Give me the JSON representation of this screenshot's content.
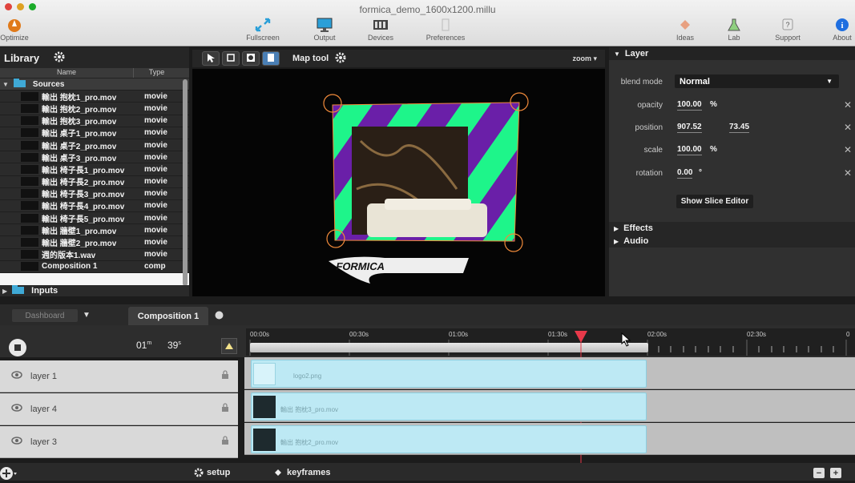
{
  "window": {
    "title": "formica_demo_1600x1200.millu"
  },
  "toolbar": {
    "optimize": "Optimize",
    "fullscreen": "Fullscreen",
    "output": "Output",
    "devices": "Devices",
    "preferences": "Preferences",
    "ideas": "Ideas",
    "lab": "Lab",
    "support": "Support",
    "about": "About"
  },
  "library": {
    "title": "Library",
    "col_name": "Name",
    "col_type": "Type",
    "sources_label": "Sources",
    "items": [
      {
        "name": "輸出 抱枕1_pro.mov",
        "type": "movie"
      },
      {
        "name": "輸出 抱枕2_pro.mov",
        "type": "movie"
      },
      {
        "name": "輸出 抱枕3_pro.mov",
        "type": "movie"
      },
      {
        "name": "輸出 桌子1_pro.mov",
        "type": "movie"
      },
      {
        "name": "輸出 桌子2_pro.mov",
        "type": "movie"
      },
      {
        "name": "輸出 桌子3_pro.mov",
        "type": "movie"
      },
      {
        "name": "輸出 椅子長1_pro.mov",
        "type": "movie"
      },
      {
        "name": "輸出 椅子長2_pro.mov",
        "type": "movie"
      },
      {
        "name": "輸出 椅子長3_pro.mov",
        "type": "movie"
      },
      {
        "name": "輸出 椅子長4_pro.mov",
        "type": "movie"
      },
      {
        "name": "輸出 椅子長5_pro.mov",
        "type": "movie"
      },
      {
        "name": "輸出 牆壁1_pro.mov",
        "type": "movie"
      },
      {
        "name": "輸出 牆壁2_pro.mov",
        "type": "movie"
      },
      {
        "name": "週的版本1.wav",
        "type": "movie"
      },
      {
        "name": "Composition 1",
        "type": "comp"
      }
    ],
    "inputs_label": "Inputs"
  },
  "preview": {
    "map_tool": "Map tool",
    "zoom": "zoom",
    "logo_text": "FORMICA"
  },
  "layer_panel": {
    "title": "Layer",
    "blend_label": "blend mode",
    "blend_value": "Normal",
    "opacity_label": "opacity",
    "opacity_value": "100.00",
    "opacity_unit": "%",
    "position_label": "position",
    "position_x": "907.52",
    "position_y": "73.45",
    "scale_label": "scale",
    "scale_value": "100.00",
    "scale_unit": "%",
    "rotation_label": "rotation",
    "rotation_value": "0.00",
    "rotation_unit": "°",
    "slice_button": "Show Slice Editor",
    "effects": "Effects",
    "audio": "Audio"
  },
  "timeline": {
    "tab_dashboard": "Dashboard",
    "tab_composition": "Composition 1",
    "duration_min": "01",
    "duration_min_unit": "m",
    "duration_sec": "39",
    "duration_sec_unit": "s",
    "ruler_labels": [
      "00:00s",
      "00:30s",
      "01:00s",
      "01:30s",
      "02:00s",
      "02:30s",
      "0"
    ],
    "tracks": [
      {
        "name": "layer 1",
        "clip": "logo2.png"
      },
      {
        "name": "layer 4",
        "clip": "輸出 抱枕3_pro.mov"
      },
      {
        "name": "layer 3",
        "clip": "輸出 抱枕2_pro.mov"
      }
    ],
    "bottom_setup": "setup",
    "bottom_keyframes": "keyframes"
  },
  "colors": {
    "accent_green": "#1ef58a",
    "accent_purple": "#6a1fa8",
    "playhead": "#e8394a",
    "handle_orange": "#f08a3a"
  }
}
